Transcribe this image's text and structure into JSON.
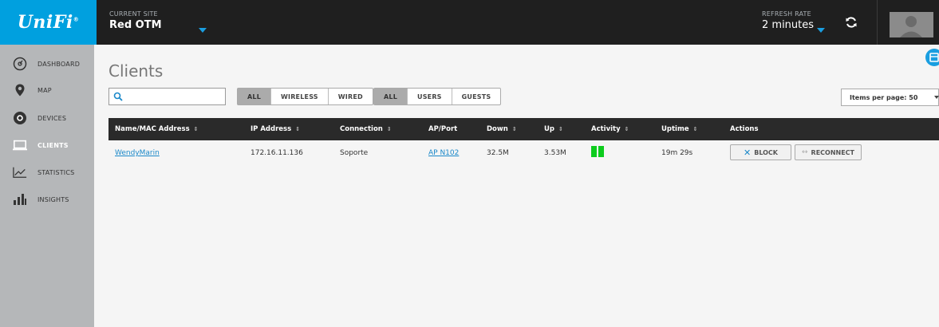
{
  "brand": {
    "logo": "UniFi",
    "registered": "®",
    "accent": "#00a0df"
  },
  "header": {
    "site_label": "CURRENT SITE",
    "site_name": "Red OTM",
    "refresh_label": "REFRESH RATE",
    "refresh_value": "2 minutes"
  },
  "sidebar": {
    "items": [
      {
        "label": "DASHBOARD",
        "icon": "dashboard-icon",
        "active": false
      },
      {
        "label": "MAP",
        "icon": "map-pin-icon",
        "active": false
      },
      {
        "label": "DEVICES",
        "icon": "devices-icon",
        "active": false
      },
      {
        "label": "CLIENTS",
        "icon": "clients-icon",
        "active": true
      },
      {
        "label": "STATISTICS",
        "icon": "statistics-icon",
        "active": false
      },
      {
        "label": "INSIGHTS",
        "icon": "insights-icon",
        "active": false
      }
    ]
  },
  "page": {
    "title": "Clients",
    "search_placeholder": "",
    "filter_type": [
      "ALL",
      "WIRELESS",
      "WIRED"
    ],
    "filter_user": [
      "ALL",
      "USERS",
      "GUESTS"
    ],
    "items_per_page": "Items per page: 50"
  },
  "table": {
    "columns": [
      "Name/MAC Address",
      "IP Address",
      "Connection",
      "AP/Port",
      "Down",
      "Up",
      "Activity",
      "Uptime",
      "Actions"
    ],
    "rows": [
      {
        "name": "WendyMarin",
        "ip": "172.16.11.136",
        "connection": "Soporte",
        "ap_port": "AP N102",
        "down": "32.5M",
        "up": "3.53M",
        "activity_color": "#0dcc1d",
        "uptime": "19m 29s",
        "block_label": "BLOCK",
        "reconnect_label": "RECONNECT"
      }
    ]
  }
}
